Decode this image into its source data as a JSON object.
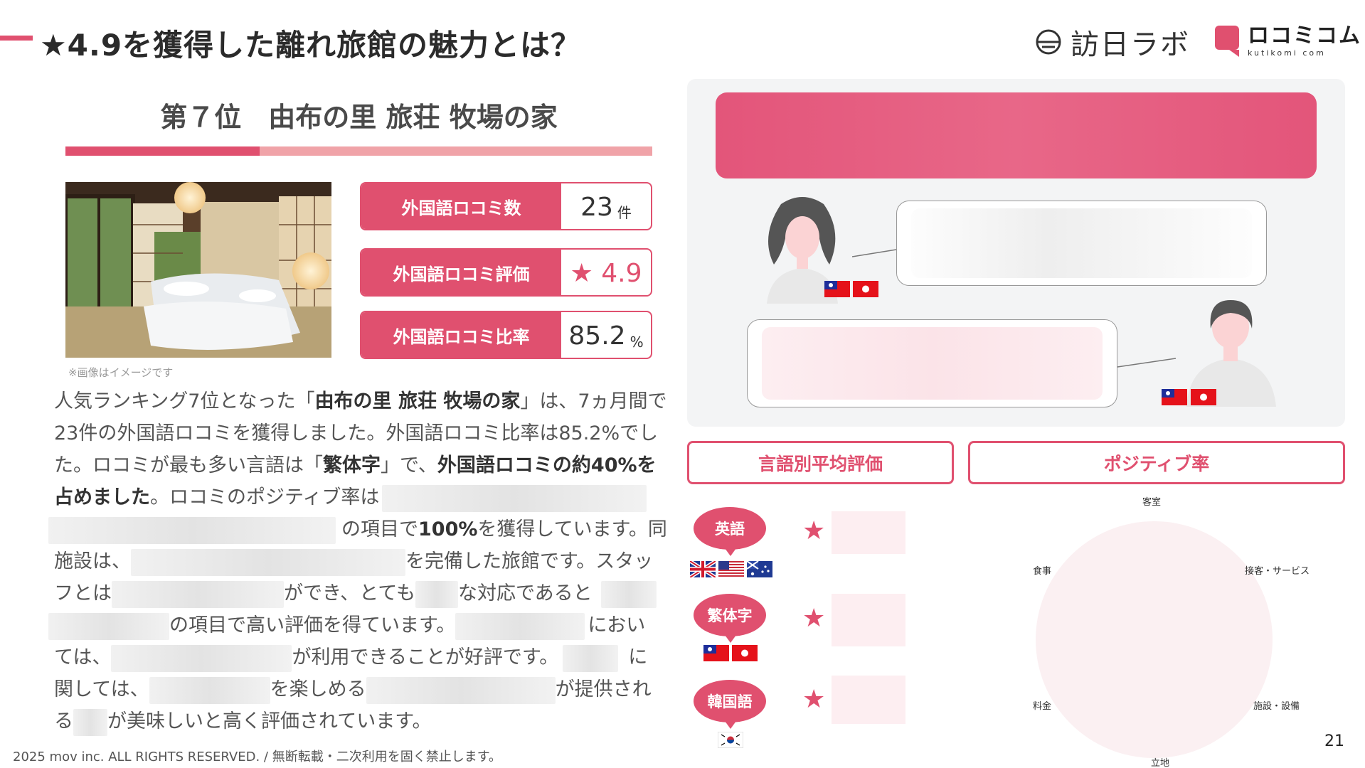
{
  "header": {
    "title": "★4.9を獲得した離れ旅館の魅力とは？",
    "logo_houjin": "訪日ラボ",
    "logo_kuti": "ロコミコム",
    "logo_kuti_sub": "kutikomi com"
  },
  "ranking": {
    "title": "第７位　由布の里 旅荘 牧場の家"
  },
  "photo": {
    "note": "※画像はイメージです"
  },
  "stats": [
    {
      "label": "外国語ロコミ数",
      "value": "23",
      "unit": "件"
    },
    {
      "label": "外国語ロコミ評価",
      "value": "★ 4.9",
      "unit": ""
    },
    {
      "label": "外国語ロコミ比率",
      "value": "85.2",
      "unit": "%"
    }
  ],
  "body": {
    "l1a": "人気ランキング7位となった「",
    "l1b": "由布の里 旅荘 牧場の家",
    "l1c": "」は、7ヵ月間で",
    "l2": "23件の外国語ロコミを獲得しました。外国語ロコミ比率は85.2%でし",
    "l3a": "た。ロコミが最も多い言語は「",
    "l3b": "繁体字",
    "l3c": "」で、",
    "l3d": "外国語ロコミの約40%を",
    "l4a": "占めました",
    "l4b": "。ロコミのポジティブ率は",
    "l5a": "の項目で",
    "l5b": "100%",
    "l5c": "を獲得しています。同",
    "l6a": "施設は、",
    "l6b": "を完備した旅館です。スタッ",
    "l7a": "フとは",
    "l7b": "ができ、とても",
    "l7c": "な対応であると",
    "l8a": "の項目で高い評価を得ています。",
    "l8b": "におい",
    "l9a": "ては、",
    "l9b": "が利用できることが好評です。",
    "l9c": "に",
    "l10a": "関しては、",
    "l10b": "を楽しめる",
    "l10c": "が提供され",
    "l11a": "る",
    "l11b": "が美味しいと高く評価されています。"
  },
  "footer": {
    "copyright": "2025 mov inc. ALL RIGHTS RESERVED. / 無断転載・二次利用を固く禁止します。",
    "page": "21"
  },
  "buttons": {
    "lang_avg": "言語別平均評価",
    "positive_rate": "ポジティブ率"
  },
  "languages": [
    {
      "label": "英語",
      "flags": [
        "uk-flag",
        "us-flag",
        "au-flag"
      ]
    },
    {
      "label": "繁体字",
      "flags": [
        "tw-flag",
        "hk-flag"
      ]
    },
    {
      "label": "韓国語",
      "flags": [
        "kr-flag"
      ]
    }
  ],
  "radar": {
    "top": "客室",
    "right_top": "接客・サービス",
    "right_bottom": "施設・設備",
    "bottom": "立地",
    "left_bottom": "料金",
    "left_top": "食事"
  },
  "colors": {
    "accent": "#e0506f",
    "accent_light": "#f0a3a8",
    "panel": "#f3f4f5"
  }
}
